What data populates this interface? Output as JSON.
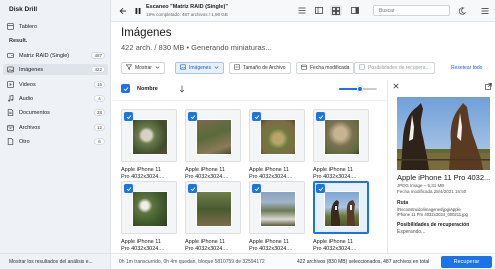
{
  "app": {
    "title": "Disk Drill"
  },
  "sidebar": {
    "dashboard_label": "Tablero",
    "section_label": "Result.",
    "items": [
      {
        "label": "Matriz RAID (Single)",
        "count": "487"
      },
      {
        "label": "Imágenes",
        "count": "422"
      },
      {
        "label": "Videos",
        "count": "15"
      },
      {
        "label": "Audio",
        "count": "4"
      },
      {
        "label": "Documentos",
        "count": "28"
      },
      {
        "label": "Archivos",
        "count": "12"
      },
      {
        "label": "Otro",
        "count": "6"
      }
    ],
    "footer": "Mostrar los resultados del análisis e..."
  },
  "topbar": {
    "scan_title": "Escaneo \"Matriz RAID (Single)\"",
    "scan_subtitle": "18% completado: 487 archivos / 1,98 GB",
    "search_placeholder": "Buscar"
  },
  "main": {
    "title": "Imágenes",
    "subtitle": "422 arch. / 830 MB • Generando miniaturas...",
    "filters": {
      "show": "Mostrar",
      "images": "Imágenes",
      "file_size": "Tamaño de Archivo",
      "modified": "Fecha modificada",
      "recovery": "Posibilidades de recupera...",
      "reset": "Resetear todo"
    },
    "column_name": "Nombre",
    "zoom_level": 0.55,
    "tiles": [
      {
        "line1": "Apple iPhone 11",
        "line2": "Pro 4032x3024...."
      },
      {
        "line1": "Apple iPhone 11",
        "line2": "Pro 4032x3024...."
      },
      {
        "line1": "Apple iPhone 11",
        "line2": "Pro 4032x3024...."
      },
      {
        "line1": "Apple iPhone 11",
        "line2": "Pro 4032x3024...."
      },
      {
        "line1": "Apple iPhone 11",
        "line2": "Pro 4032x3024...."
      },
      {
        "line1": "Apple iPhone 11",
        "line2": "Pro 4032x3024...."
      },
      {
        "line1": "Apple iPhone 11",
        "line2": "Pro 4032x3024...."
      },
      {
        "line1": "Apple iPhone 11",
        "line2": "Pro 4032x3024...."
      }
    ]
  },
  "status": {
    "left": "0h 1m transcurrido, 0h 4m quedan, bloque 5810759 de 32594172",
    "right": "422 archivos (830 MB) seleccionados, 487 archivos en total",
    "recover_button": "Recuperar"
  },
  "preview": {
    "title": "Apple iPhone 11 Pro 4032...",
    "meta_type": "JPEG Image – 5,31 MB",
    "meta_date": "Fecha modificada 28/4/2021 15:50",
    "path_label": "Ruta",
    "path_line1": "\\Reconstruido\\imagenes\\jpg\\Apple",
    "path_line2": "iPhone 11 Pro 4032x3024_000211.jpg",
    "recovery_label": "Posibilidades de recuperación",
    "recovery_value": "Esperando..."
  },
  "colors": {
    "accent": "#1a73e8",
    "sidebar_bg": "#eef1f5"
  }
}
